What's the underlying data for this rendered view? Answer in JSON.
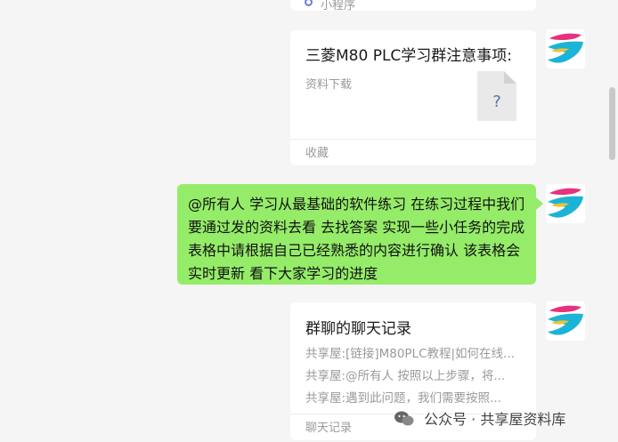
{
  "top_card": {
    "label": "小程序"
  },
  "file_card": {
    "title": "三菱M80 PLC学习群注意事项:",
    "subtitle": "资料下载",
    "file_icon_glyph": "?",
    "footer": "收藏"
  },
  "message": {
    "text": "@所有人 学习从最基础的软件练习 在练习过程中我们要通过发的资料去看 去找答案 实现一些小任务的完成 表格中请根据自己已经熟悉的内容进行确认 该表格会实时更新 看下大家学习的进度"
  },
  "record_card": {
    "title": "群聊的聊天记录",
    "lines": [
      "共享屋:[链接]M80PLC教程|如何在线...",
      "共享屋:@所有人 按照以上步骤，将...",
      "共享屋:遇到此问题，我们需要按照..."
    ],
    "footer": "聊天记录"
  },
  "watermark": {
    "text": "公众号 · 共享屋资料库"
  },
  "colors": {
    "bubble": "#95ec69",
    "background": "#f5f5f5",
    "avatar_teal": "#1bb4d6",
    "avatar_pink": "#e8317e"
  }
}
